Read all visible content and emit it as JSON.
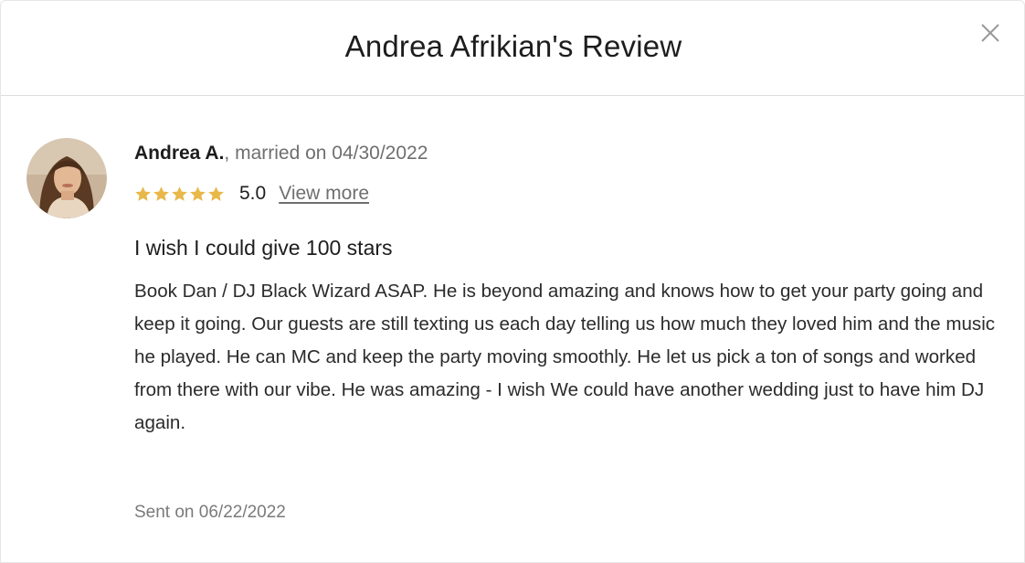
{
  "modal": {
    "title": "Andrea Afrikian's Review",
    "close_icon": "close-icon"
  },
  "reviewer": {
    "name": "Andrea A.",
    "married_text": ", married on 04/30/2022",
    "avatar_icon": "avatar-photo"
  },
  "rating": {
    "stars": 5,
    "max_stars": 5,
    "value": "5.0",
    "view_more_label": "View more",
    "star_color": "#e8b84a"
  },
  "review": {
    "title": "I wish I could give 100 stars",
    "text": "Book Dan / DJ Black Wizard ASAP. He is beyond amazing and knows how to get your party going and keep it going. Our guests are still texting us each day telling us how much they loved him and the music he played. He can MC and keep the party moving smoothly. He let us pick a ton of songs and worked from there with our vibe. He was amazing - I wish We could have another wedding just to have him DJ again.",
    "sent_on": "Sent on 06/22/2022"
  }
}
